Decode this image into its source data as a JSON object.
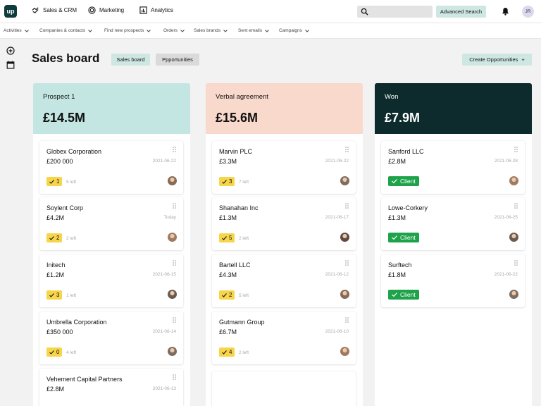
{
  "app": {
    "logo_text": "up",
    "nav": [
      {
        "label": "Sales & CRM",
        "icon": "handshake-icon"
      },
      {
        "label": "Marketing",
        "icon": "target-icon"
      },
      {
        "label": "Analytics",
        "icon": "chart-icon"
      }
    ],
    "search_placeholder": "",
    "advanced_search_label": "Advanced Search",
    "user_initials": "JR"
  },
  "subnav": [
    "Activities",
    "Companies & contacts",
    "Find new prospects",
    "Orders",
    "Sales brands",
    "Sent emails",
    "Campaigns"
  ],
  "page": {
    "title": "Sales board",
    "tabs": [
      "Sales board",
      "Ppportunities"
    ],
    "create_button": "Create Opportunities",
    "create_icon": "+"
  },
  "columns": [
    {
      "name": "Prospect 1",
      "total": "£14.5M",
      "head_color": "#c3e6e3",
      "head_text_color": "#111111",
      "cards": [
        {
          "name": "Globex Corporation",
          "value": "£200 000",
          "date": "2021-06-22",
          "count": "1",
          "left": "5 left"
        },
        {
          "name": "Soylent Corp",
          "value": "£4.2M",
          "date": "Today",
          "count": "2",
          "left": "2 left"
        },
        {
          "name": "Initech",
          "value": "£1.2M",
          "date": "2021-06-15",
          "count": "3",
          "left": "1 left"
        },
        {
          "name": "Umbrella Corporation",
          "value": "£350 000",
          "date": "2021-06-14",
          "count": "0",
          "left": "4 left"
        },
        {
          "name": "Vehement Capital Partners",
          "value": "£2.8M",
          "date": "2021-06-13",
          "count": "",
          "left": ""
        }
      ]
    },
    {
      "name": "Verbal agreement",
      "total": "£15.6M",
      "head_color": "#f8d9cb",
      "head_text_color": "#111111",
      "cards": [
        {
          "name": "Marvin PLC",
          "value": "£3.3M",
          "date": "2021-06-22",
          "count": "3",
          "left": "7 left"
        },
        {
          "name": "Shanahan Inc",
          "value": "£1.3M",
          "date": "2021-06-17",
          "count": "5",
          "left": "2 left"
        },
        {
          "name": "Bartell LLC",
          "value": "£4.3M",
          "date": "2021-06-12",
          "count": "2",
          "left": "5 left"
        },
        {
          "name": "Gutmann Group",
          "value": "£6.7M",
          "date": "2021-06-10",
          "count": "4",
          "left": "2 left"
        }
      ]
    },
    {
      "name": "Won",
      "total": "£7.9M",
      "head_color": "#0d2a2c",
      "head_text_color": "#ffffff",
      "cards": [
        {
          "name": "Sanford LLC",
          "value": "£2.8M",
          "date": "2021-06-28",
          "status": "Client"
        },
        {
          "name": "Lowe-Corkery",
          "value": "£1.3M",
          "date": "2021-06-25",
          "status": "Client"
        },
        {
          "name": "Surftech",
          "value": "£1.8M",
          "date": "2021-06-22",
          "status": "Client"
        }
      ]
    }
  ],
  "colors": {
    "accent_teal": "#cfe7e3",
    "badge_yellow": "#f7d54a",
    "client_green": "#1ea34b"
  }
}
